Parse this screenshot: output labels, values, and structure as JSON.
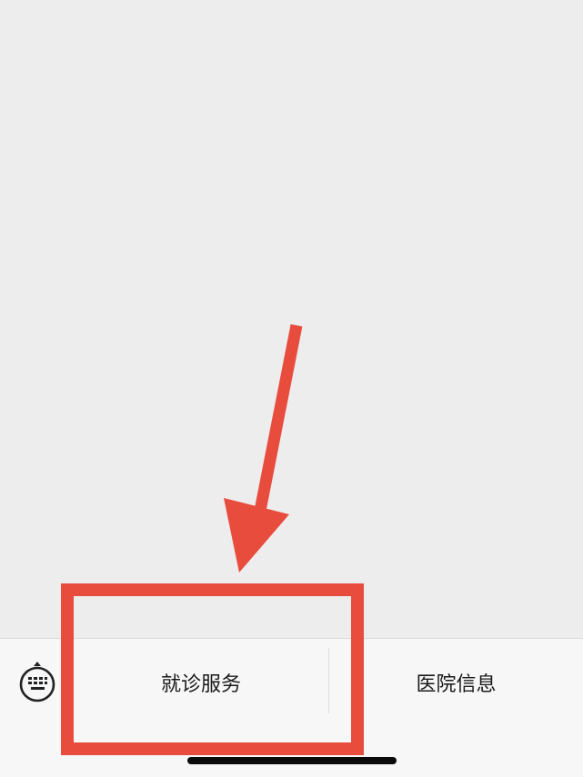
{
  "menu": {
    "items": [
      {
        "label": "就诊服务",
        "highlighted": true
      },
      {
        "label": "医院信息",
        "highlighted": false
      }
    ]
  },
  "icons": {
    "keyboard_toggle": "keyboard-icon"
  },
  "annotation": {
    "color": "#e84c3d",
    "type": "arrow-and-box"
  }
}
